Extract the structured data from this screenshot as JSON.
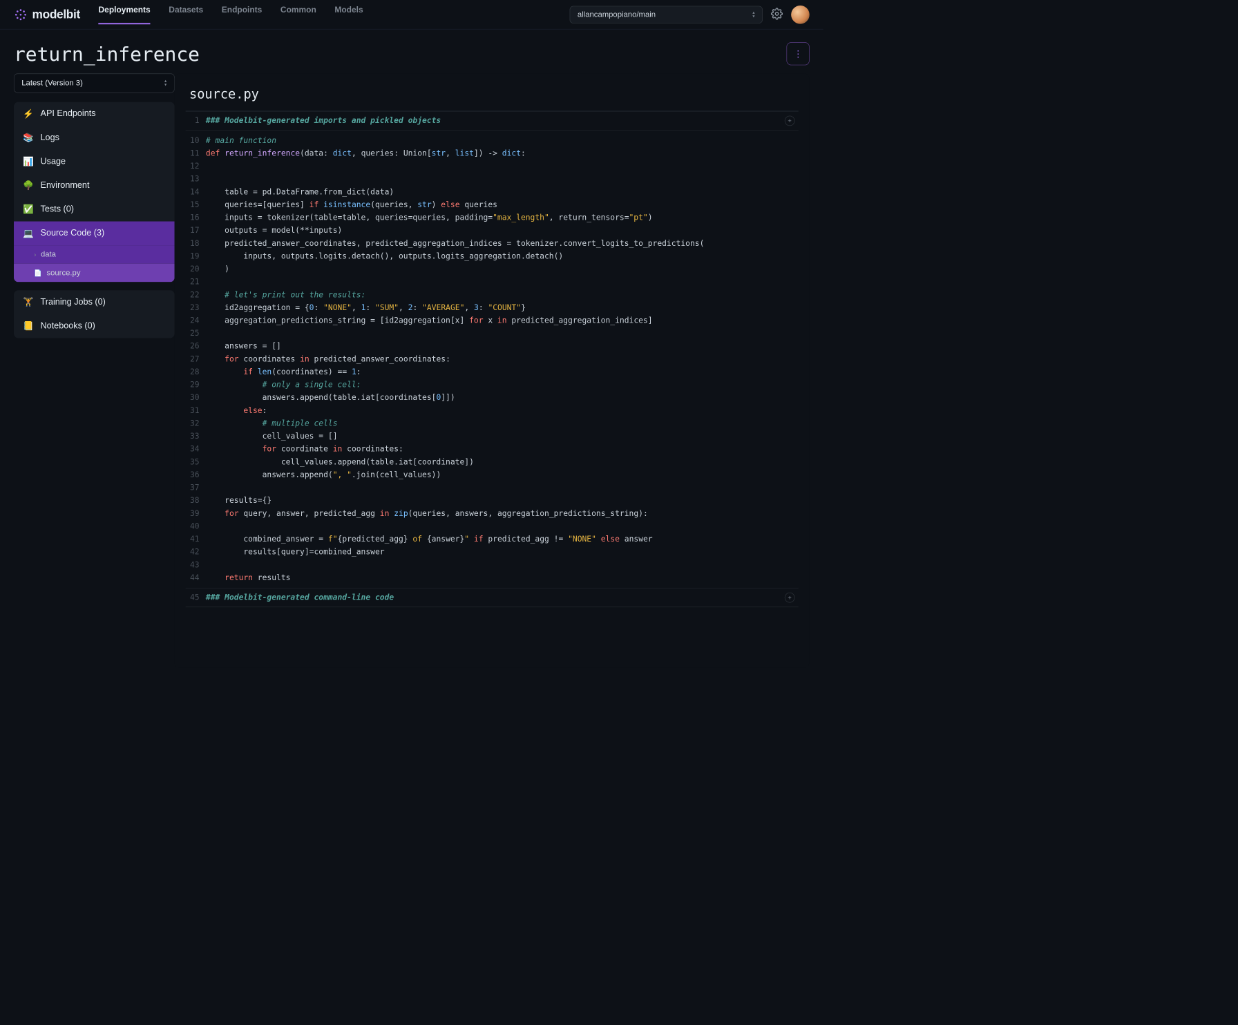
{
  "brand": "modelbit",
  "nav": {
    "items": [
      "Deployments",
      "Datasets",
      "Endpoints",
      "Common",
      "Models"
    ],
    "active": "Deployments"
  },
  "branch": "allancampopiano/main",
  "page_title": "return_inference",
  "version": "Latest (Version 3)",
  "sidebar": {
    "group1": [
      {
        "icon": "⚡",
        "label": "API Endpoints"
      },
      {
        "icon": "📚",
        "label": "Logs"
      },
      {
        "icon": "📊",
        "label": "Usage"
      },
      {
        "icon": "🌳",
        "label": "Environment"
      },
      {
        "icon": "✅",
        "label": "Tests (0)"
      },
      {
        "icon": "💻",
        "label": "Source Code (3)"
      }
    ],
    "subitems": [
      {
        "icon": "›",
        "label": "data"
      },
      {
        "icon": "🐍",
        "label": "source.py"
      }
    ],
    "group2": [
      {
        "icon": "🏋️",
        "label": "Training Jobs (0)"
      },
      {
        "icon": "📒",
        "label": "Notebooks (0)"
      }
    ]
  },
  "filename": "source.py",
  "code_fold_1": {
    "line": 1,
    "text": "### Modelbit-generated imports and pickled objects"
  },
  "code_lines": [
    {
      "n": 10,
      "html": "<span class='c-comment'># main function</span>"
    },
    {
      "n": 11,
      "html": "<span class='c-kw'>def</span> <span class='c-def'>return_inference</span>(data: <span class='c-builtin'>dict</span>, queries: Union[<span class='c-builtin'>str</span>, <span class='c-builtin'>list</span>]) -&gt; <span class='c-builtin'>dict</span>:"
    },
    {
      "n": 12,
      "html": ""
    },
    {
      "n": 13,
      "html": ""
    },
    {
      "n": 14,
      "html": "    table = pd.DataFrame.from_dict(data)"
    },
    {
      "n": 15,
      "html": "    queries=[queries] <span class='c-kw'>if</span> <span class='c-builtin'>isinstance</span>(queries, <span class='c-builtin'>str</span>) <span class='c-kw'>else</span> queries"
    },
    {
      "n": 16,
      "html": "    inputs = tokenizer(table=table, queries=queries, padding=<span class='c-str'>\"max_length\"</span>, return_tensors=<span class='c-str'>\"pt\"</span>)"
    },
    {
      "n": 17,
      "html": "    outputs = model(**inputs)"
    },
    {
      "n": 18,
      "html": "    predicted_answer_coordinates, predicted_aggregation_indices = tokenizer.convert_logits_to_predictions("
    },
    {
      "n": 19,
      "html": "        inputs, outputs.logits.detach(), outputs.logits_aggregation.detach()"
    },
    {
      "n": 20,
      "html": "    )"
    },
    {
      "n": 21,
      "html": ""
    },
    {
      "n": 22,
      "html": "    <span class='c-comment'># let's print out the results:</span>"
    },
    {
      "n": 23,
      "html": "    id2aggregation = {<span class='c-num'>0</span>: <span class='c-str'>\"NONE\"</span>, <span class='c-num'>1</span>: <span class='c-str'>\"SUM\"</span>, <span class='c-num'>2</span>: <span class='c-str'>\"AVERAGE\"</span>, <span class='c-num'>3</span>: <span class='c-str'>\"COUNT\"</span>}"
    },
    {
      "n": 24,
      "html": "    aggregation_predictions_string = [id2aggregation[x] <span class='c-kw'>for</span> x <span class='c-kw'>in</span> predicted_aggregation_indices]"
    },
    {
      "n": 25,
      "html": ""
    },
    {
      "n": 26,
      "html": "    answers = []"
    },
    {
      "n": 27,
      "html": "    <span class='c-kw'>for</span> coordinates <span class='c-kw'>in</span> predicted_answer_coordinates:"
    },
    {
      "n": 28,
      "html": "        <span class='c-kw'>if</span> <span class='c-builtin'>len</span>(coordinates) == <span class='c-num'>1</span>:"
    },
    {
      "n": 29,
      "html": "            <span class='c-comment'># only a single cell:</span>"
    },
    {
      "n": 30,
      "html": "            answers.append(table.iat[coordinates[<span class='c-num'>0</span>]])"
    },
    {
      "n": 31,
      "html": "        <span class='c-kw'>else</span>:"
    },
    {
      "n": 32,
      "html": "            <span class='c-comment'># multiple cells</span>"
    },
    {
      "n": 33,
      "html": "            cell_values = []"
    },
    {
      "n": 34,
      "html": "            <span class='c-kw'>for</span> coordinate <span class='c-kw'>in</span> coordinates:"
    },
    {
      "n": 35,
      "html": "                cell_values.append(table.iat[coordinate])"
    },
    {
      "n": 36,
      "html": "            answers.append(<span class='c-str'>\", \"</span>.join(cell_values))"
    },
    {
      "n": 37,
      "html": ""
    },
    {
      "n": 38,
      "html": "    results={}"
    },
    {
      "n": 39,
      "html": "    <span class='c-kw'>for</span> query, answer, predicted_agg <span class='c-kw'>in</span> <span class='c-builtin'>zip</span>(queries, answers, aggregation_predictions_string):"
    },
    {
      "n": 40,
      "html": ""
    },
    {
      "n": 41,
      "html": "        combined_answer = <span class='c-str'>f\"</span>{predicted_agg}<span class='c-str'> of </span>{answer}<span class='c-str'>\"</span> <span class='c-kw'>if</span> predicted_agg != <span class='c-str'>\"NONE\"</span> <span class='c-kw'>else</span> answer"
    },
    {
      "n": 42,
      "html": "        results[query]=combined_answer"
    },
    {
      "n": 43,
      "html": ""
    },
    {
      "n": 44,
      "html": "    <span class='c-kw'>return</span> results"
    }
  ],
  "code_fold_2": {
    "line": 45,
    "text": "### Modelbit-generated command-line code"
  }
}
